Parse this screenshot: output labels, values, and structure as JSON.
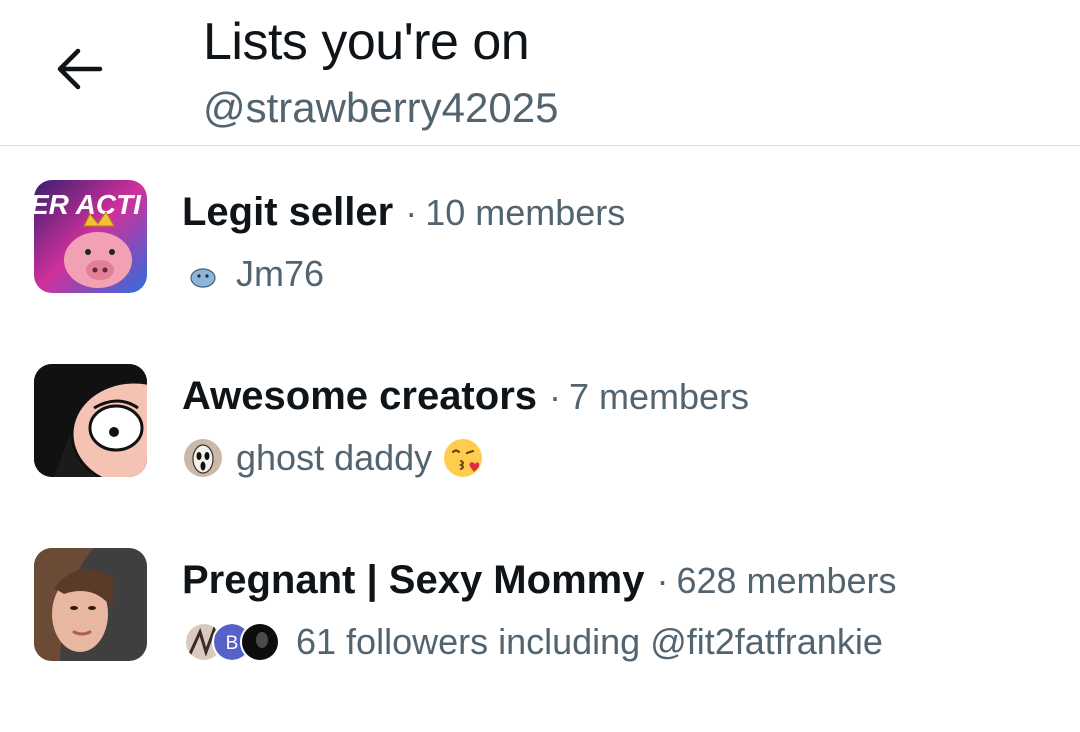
{
  "header": {
    "title": "Lists you're on",
    "subtitle": "@strawberry42025"
  },
  "lists": [
    {
      "name": "Legit seller",
      "separator": "·",
      "members": "10 members",
      "owner": "Jm76",
      "thumb_text": "ER ACTI"
    },
    {
      "name": "Awesome creators",
      "separator": "·",
      "members": "7 members",
      "owner": "ghost daddy"
    },
    {
      "name": "Pregnant | Sexy Mommy",
      "separator": "·",
      "members": "628 members",
      "followers_text": "61 followers including @fit2fatfrankie",
      "follower_badge": "B"
    }
  ],
  "icons": {
    "back": "arrow-left-icon",
    "kiss": "face-blowing-kiss-icon"
  },
  "colors": {
    "primary_text": "#0f1419",
    "secondary_text": "#536471",
    "divider": "#dcdfe2"
  }
}
